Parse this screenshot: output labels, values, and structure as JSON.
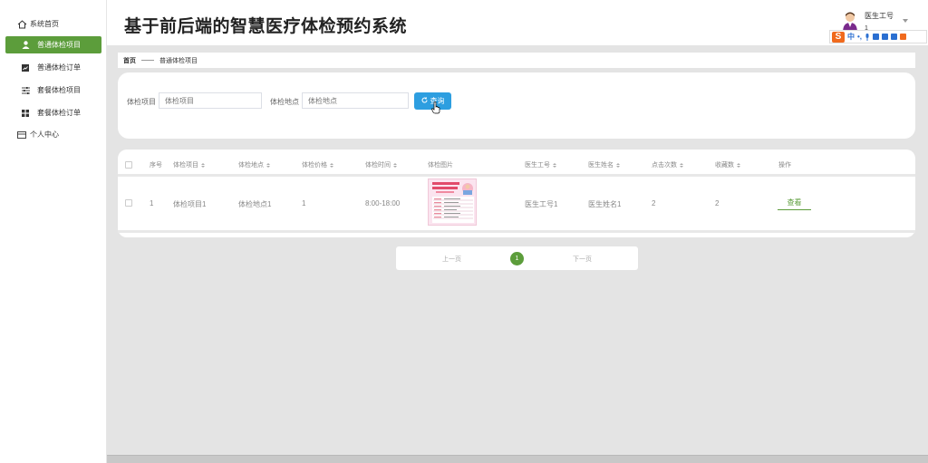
{
  "sidebar": {
    "items": [
      {
        "label": "系统首页",
        "icon": "home-icon"
      },
      {
        "label": "普通体检项目",
        "icon": "user-icon",
        "active": true
      },
      {
        "label": "普通体检订单",
        "icon": "chart-icon"
      },
      {
        "label": "套餐体检项目",
        "icon": "sliders-icon"
      },
      {
        "label": "套餐体检订单",
        "icon": "grid-icon"
      },
      {
        "label": "个人中心",
        "icon": "card-icon"
      }
    ]
  },
  "header": {
    "title": "基于前后端的智慧医疗体检预约系统",
    "user_role": "医生工号",
    "user_sub": "1"
  },
  "ime": {
    "mode": "中"
  },
  "breadcrumb": {
    "home": "首页",
    "separator": "——",
    "current": "普通体检项目"
  },
  "search": {
    "item_label": "体检项目",
    "item_placeholder": "体检项目",
    "place_label": "体检地点",
    "place_placeholder": "体检地点",
    "button_label": "查询"
  },
  "table": {
    "headers": [
      "序号",
      "体检项目",
      "体检地点",
      "体检价格",
      "体检时间",
      "体检图片",
      "医生工号",
      "医生姓名",
      "点击次数",
      "收藏数",
      "操作"
    ],
    "rows": [
      {
        "index": "1",
        "item": "体检项目1",
        "place": "体检地点1",
        "price": "1",
        "time": "8:00-18:00",
        "doctor_id": "医生工号1",
        "doctor_name": "医生姓名1",
        "clicks": "2",
        "favorites": "2",
        "action": "查看"
      }
    ]
  },
  "pagination": {
    "prev": "上一页",
    "current": "1",
    "next": "下一页"
  },
  "colors": {
    "accent": "#5c9d3b",
    "button": "#2d9ee0",
    "background": "#e4e4e4"
  }
}
